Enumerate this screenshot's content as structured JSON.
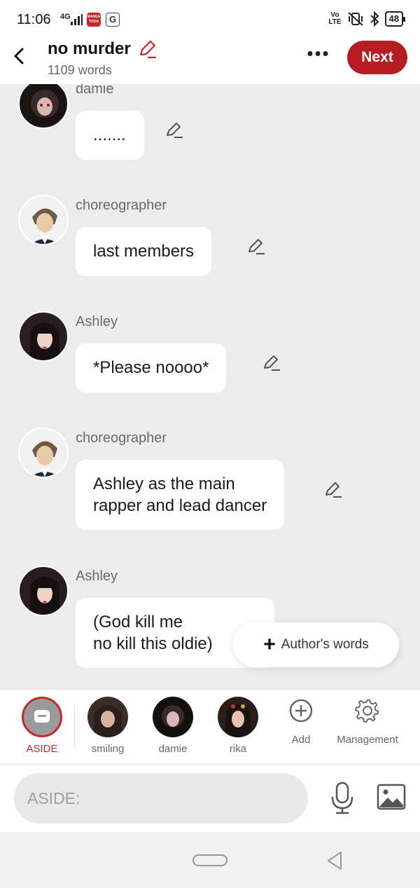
{
  "status_bar": {
    "time": "11:06",
    "network": "4G",
    "battery": "48",
    "volte": "Vo\nLTE"
  },
  "header": {
    "title": "no murder",
    "subtitle": "1109 words",
    "next_label": "Next",
    "more_label": "•••"
  },
  "messages": [
    {
      "sender": "damie",
      "text": "......."
    },
    {
      "sender": "choreographer",
      "text": "last members"
    },
    {
      "sender": "Ashley",
      "text": "*Please noooo*"
    },
    {
      "sender": "choreographer",
      "text": "Ashley as the main\nrapper and lead dancer"
    },
    {
      "sender": "Ashley",
      "text": "(God kill me\nno kill this oldie)"
    }
  ],
  "authors_words": "Author's words",
  "character_bar": {
    "items": [
      {
        "label": "ASIDE"
      },
      {
        "label": "smiling"
      },
      {
        "label": "damie"
      },
      {
        "label": "rika"
      }
    ],
    "add_label": "Add",
    "management_label": "Management"
  },
  "input": {
    "placeholder": "ASIDE:"
  },
  "colors": {
    "accent": "#b71c22",
    "background": "#ececec"
  }
}
